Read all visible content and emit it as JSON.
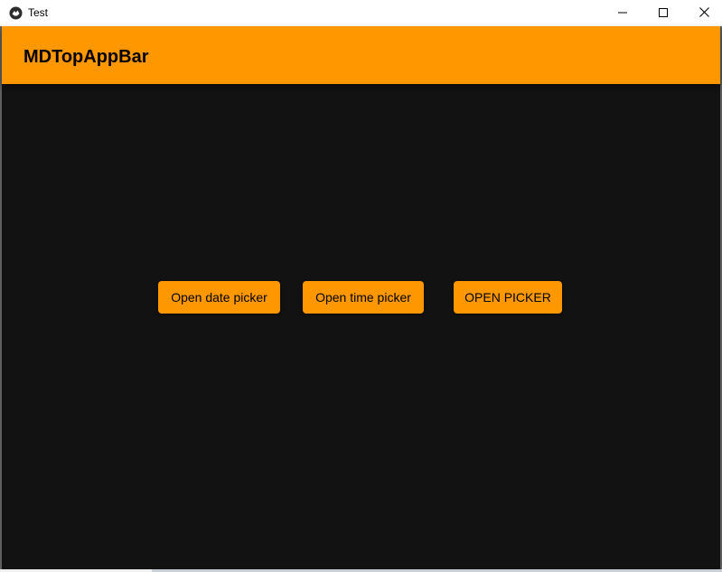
{
  "window": {
    "title": "Test",
    "app_icon": "kivy-icon",
    "controls": {
      "minimize_icon": "minimize-icon",
      "maximize_icon": "maximize-icon",
      "close_icon": "close-icon"
    }
  },
  "appbar": {
    "title": "MDTopAppBar",
    "color": "#ff9800"
  },
  "main": {
    "background": "#121212",
    "buttons": [
      {
        "label": "Open date picker"
      },
      {
        "label": "Open time picker"
      },
      {
        "label": "OPEN PICKER"
      }
    ]
  }
}
